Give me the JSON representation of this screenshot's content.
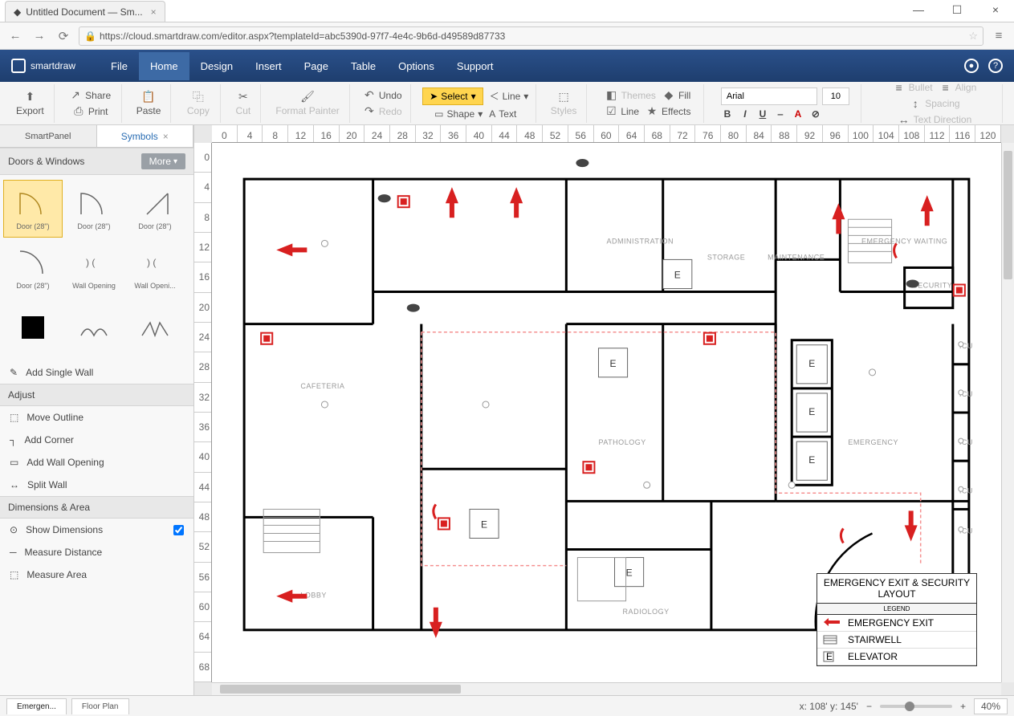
{
  "browser": {
    "tab_title": "Untitled Document — Sm...",
    "url": "https://cloud.smartdraw.com/editor.aspx?templateId=abc5390d-97f7-4e4c-9b6d-d49589d87733"
  },
  "app": {
    "brand": "smartdraw"
  },
  "menu": {
    "items": [
      "File",
      "Home",
      "Design",
      "Insert",
      "Page",
      "Table",
      "Options",
      "Support"
    ],
    "active": "Home"
  },
  "ribbon": {
    "export": "Export",
    "share": "Share",
    "print": "Print",
    "paste": "Paste",
    "copy": "Copy",
    "cut": "Cut",
    "format_painter": "Format Painter",
    "undo": "Undo",
    "redo": "Redo",
    "select": "Select",
    "shape": "Shape",
    "line": "Line",
    "text": "Text",
    "styles": "Styles",
    "themes": "Themes",
    "line2": "Line",
    "fill": "Fill",
    "effects": "Effects",
    "font": "Arial",
    "font_size": "10",
    "bullet": "Bullet",
    "align": "Align",
    "spacing": "Spacing",
    "text_dir": "Text Direction"
  },
  "sidepanel": {
    "tabs": [
      "SmartPanel",
      "Symbols"
    ],
    "active": "Symbols",
    "section_doors": "Doors & Windows",
    "more": "More",
    "symbols": [
      {
        "label": "Door (28\")"
      },
      {
        "label": "Door (28\")"
      },
      {
        "label": "Door (28\")"
      },
      {
        "label": "Door (28\")"
      },
      {
        "label": "Wall Opening"
      },
      {
        "label": "Wall Openi..."
      }
    ],
    "add_wall": "Add Single Wall",
    "section_adjust": "Adjust",
    "adjust_items": [
      "Move Outline",
      "Add Corner",
      "Add Wall Opening",
      "Split Wall"
    ],
    "section_dim": "Dimensions & Area",
    "dim_items": [
      "Show Dimensions",
      "Measure Distance",
      "Measure Area"
    ]
  },
  "ruler_h": [
    "0",
    "4",
    "8",
    "12",
    "16",
    "20",
    "24",
    "28",
    "32",
    "36",
    "40",
    "44",
    "48",
    "52",
    "56",
    "60",
    "64",
    "68",
    "72",
    "76",
    "80",
    "84",
    "88",
    "92",
    "96",
    "100",
    "104",
    "108",
    "112",
    "116",
    "120"
  ],
  "ruler_v": [
    "0",
    "4",
    "8",
    "12",
    "16",
    "20",
    "24",
    "28",
    "32",
    "36",
    "40",
    "44",
    "48",
    "52",
    "56",
    "60",
    "64",
    "68"
  ],
  "plan": {
    "rooms": [
      "ADMINISTRATION",
      "STORAGE",
      "MAINTENANCE",
      "SECURITY",
      "EMERGENCY WAITING",
      "CAFETERIA",
      "PATHOLOGY",
      "EMERGENCY",
      "LOBBY",
      "RADIOLOGY",
      "ICU",
      "ICU",
      "ICU",
      "ICU",
      "ICU"
    ],
    "elevator": "E"
  },
  "legend": {
    "title": "EMERGENCY EXIT & SECURITY LAYOUT",
    "sub": "LEGEND",
    "rows": [
      "EMERGENCY EXIT",
      "STAIRWELL",
      "ELEVATOR"
    ]
  },
  "statusbar": {
    "tabs": [
      "Emergen...",
      "Floor Plan"
    ],
    "cursor": "x: 108'   y: 145'",
    "zoom": "40%"
  }
}
